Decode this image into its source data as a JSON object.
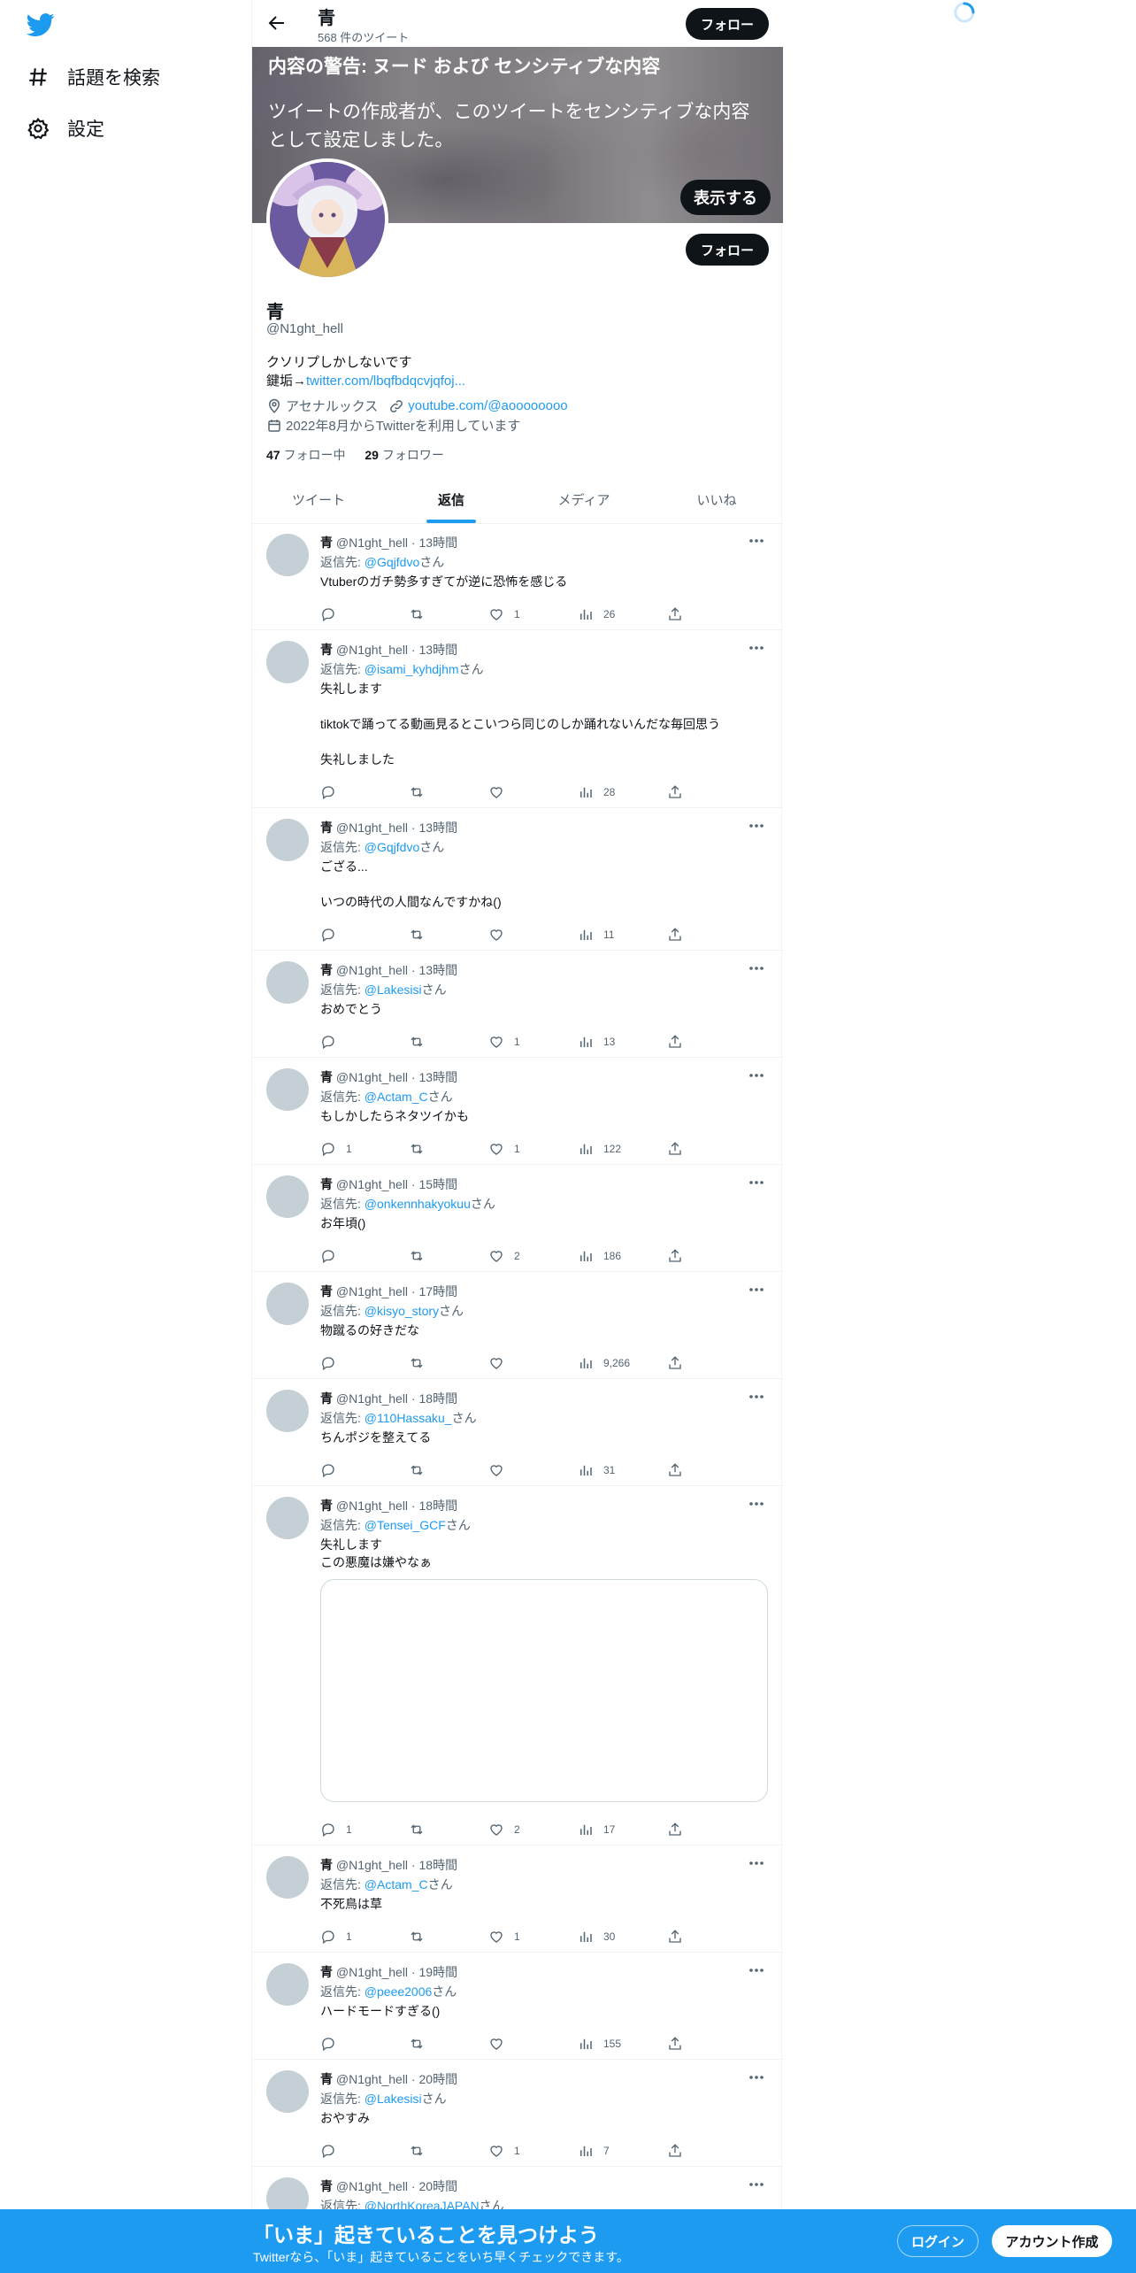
{
  "nav": {
    "logo_icon": "twitter-bird-icon",
    "items": [
      {
        "label": "話題を検索",
        "icon": "hashtag-icon"
      },
      {
        "label": "設定",
        "icon": "gear-icon"
      }
    ]
  },
  "header": {
    "name": "青",
    "tweet_count": "568 件のツイート",
    "follow_label": "フォロー"
  },
  "banner": {
    "warning_title": "内容の警告: ヌード および センシティブな内容",
    "warning_body": "ツイートの作成者が、このツイートをセンシティブな内容として設定しました。",
    "show_label": "表示する"
  },
  "profile": {
    "name": "青",
    "handle": "@N1ght_hell",
    "follow_label": "フォロー",
    "bio_line1": "クソリプしかしないです",
    "bio_line2_prefix": "鍵垢→",
    "bio_link": "twitter.com/lbqfbdqcvjqfoj...",
    "location": "アセナルックス",
    "website": "youtube.com/@aoooooooo",
    "joined": "2022年8月からTwitterを利用しています",
    "following_count": "47",
    "following_label": "フォロー中",
    "followers_count": "29",
    "followers_label": "フォロワー"
  },
  "tabs": [
    {
      "label": "ツイート",
      "active": false
    },
    {
      "label": "返信",
      "active": true
    },
    {
      "label": "メディア",
      "active": false
    },
    {
      "label": "いいね",
      "active": false
    }
  ],
  "reply_prefix": "返信先: ",
  "reply_suffix": "さん",
  "tweets": [
    {
      "name": "青",
      "handle": "@N1ght_hell",
      "time": "13時間",
      "reply_to": "@Gqjfdvo",
      "text": "Vtuberのガチ勢多すぎてが逆に恐怖を感じる",
      "replies": "",
      "likes": "1",
      "views": "26"
    },
    {
      "name": "青",
      "handle": "@N1ght_hell",
      "time": "13時間",
      "reply_to": "@isami_kyhdjhm",
      "text": "失礼します\n\ntiktokで踊ってる動画見るとこいつら同じのしか踊れないんだな毎回思う\n\n失礼しました",
      "replies": "",
      "likes": "",
      "views": "28"
    },
    {
      "name": "青",
      "handle": "@N1ght_hell",
      "time": "13時間",
      "reply_to": "@Gqjfdvo",
      "text": "ござる...\n\nいつの時代の人間なんですかね()",
      "replies": "",
      "likes": "",
      "views": "11"
    },
    {
      "name": "青",
      "handle": "@N1ght_hell",
      "time": "13時間",
      "reply_to": "@Lakesisi",
      "text": "おめでとう",
      "replies": "",
      "likes": "1",
      "views": "13"
    },
    {
      "name": "青",
      "handle": "@N1ght_hell",
      "time": "13時間",
      "reply_to": "@Actam_C",
      "text": "もしかしたらネタツイかも",
      "replies": "1",
      "likes": "1",
      "views": "122"
    },
    {
      "name": "青",
      "handle": "@N1ght_hell",
      "time": "15時間",
      "reply_to": "@onkennhakyokuu",
      "text": "お年頃()",
      "replies": "",
      "likes": "2",
      "views": "186"
    },
    {
      "name": "青",
      "handle": "@N1ght_hell",
      "time": "17時間",
      "reply_to": "@kisyo_story",
      "text": "物蹴るの好きだな",
      "replies": "",
      "likes": "",
      "views": "9,266"
    },
    {
      "name": "青",
      "handle": "@N1ght_hell",
      "time": "18時間",
      "reply_to": "@110Hassaku_",
      "text": "ちんポジを整えてる",
      "replies": "",
      "likes": "",
      "views": "31"
    },
    {
      "name": "青",
      "handle": "@N1ght_hell",
      "time": "18時間",
      "reply_to": "@Tensei_GCF",
      "text": "失礼します\nこの悪魔は嫌やなぁ",
      "replies": "1",
      "likes": "2",
      "views": "17"
    },
    {
      "name": "青",
      "handle": "@N1ght_hell",
      "time": "18時間",
      "reply_to": "@Actam_C",
      "text": "不死鳥は草",
      "replies": "1",
      "likes": "1",
      "views": "30"
    },
    {
      "name": "青",
      "handle": "@N1ght_hell",
      "time": "19時間",
      "reply_to": "@peee2006",
      "text": "ハードモードすぎる()",
      "replies": "",
      "likes": "",
      "views": "155"
    },
    {
      "name": "青",
      "handle": "@N1ght_hell",
      "time": "20時間",
      "reply_to": "@Lakesisi",
      "text": "おやすみ",
      "replies": "",
      "likes": "1",
      "views": "7"
    },
    {
      "name": "青",
      "handle": "@N1ght_hell",
      "time": "20時間",
      "reply_to": "@NorthKoreaJAPAN",
      "text": "",
      "replies": "",
      "likes": "",
      "views": ""
    }
  ],
  "bottom_bar": {
    "title": "「いま」起きていることを見つけよう",
    "subtitle": "Twitterなら、「いま」起きていることをいち早くチェックできます。",
    "login_label": "ログイン",
    "signup_label": "アカウント作成"
  },
  "colors": {
    "accent": "#1d9bf0",
    "text": "#0f1419",
    "muted": "#536471",
    "avatar_placeholder": "#c4cfd6"
  }
}
